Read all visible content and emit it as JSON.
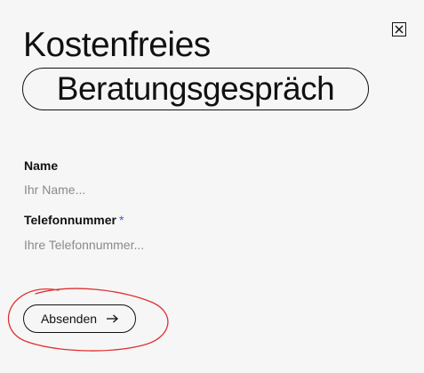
{
  "dialog": {
    "title_line1": "Kostenfreies",
    "title_highlight": "Beratungsgespräch",
    "close_icon": "close-icon"
  },
  "form": {
    "name": {
      "label": "Name",
      "value": "",
      "placeholder": "Ihr Name..."
    },
    "phone": {
      "label": "Telefonnummer",
      "required_marker": "*",
      "value": "",
      "placeholder": "Ihre Telefonnummer..."
    },
    "submit_label": "Absenden",
    "submit_icon": "arrow-right-icon"
  },
  "colors": {
    "background": "#f6f6f6",
    "text": "#111111",
    "required_marker": "#3a5bd9",
    "annotation_circle": "#e03030"
  }
}
